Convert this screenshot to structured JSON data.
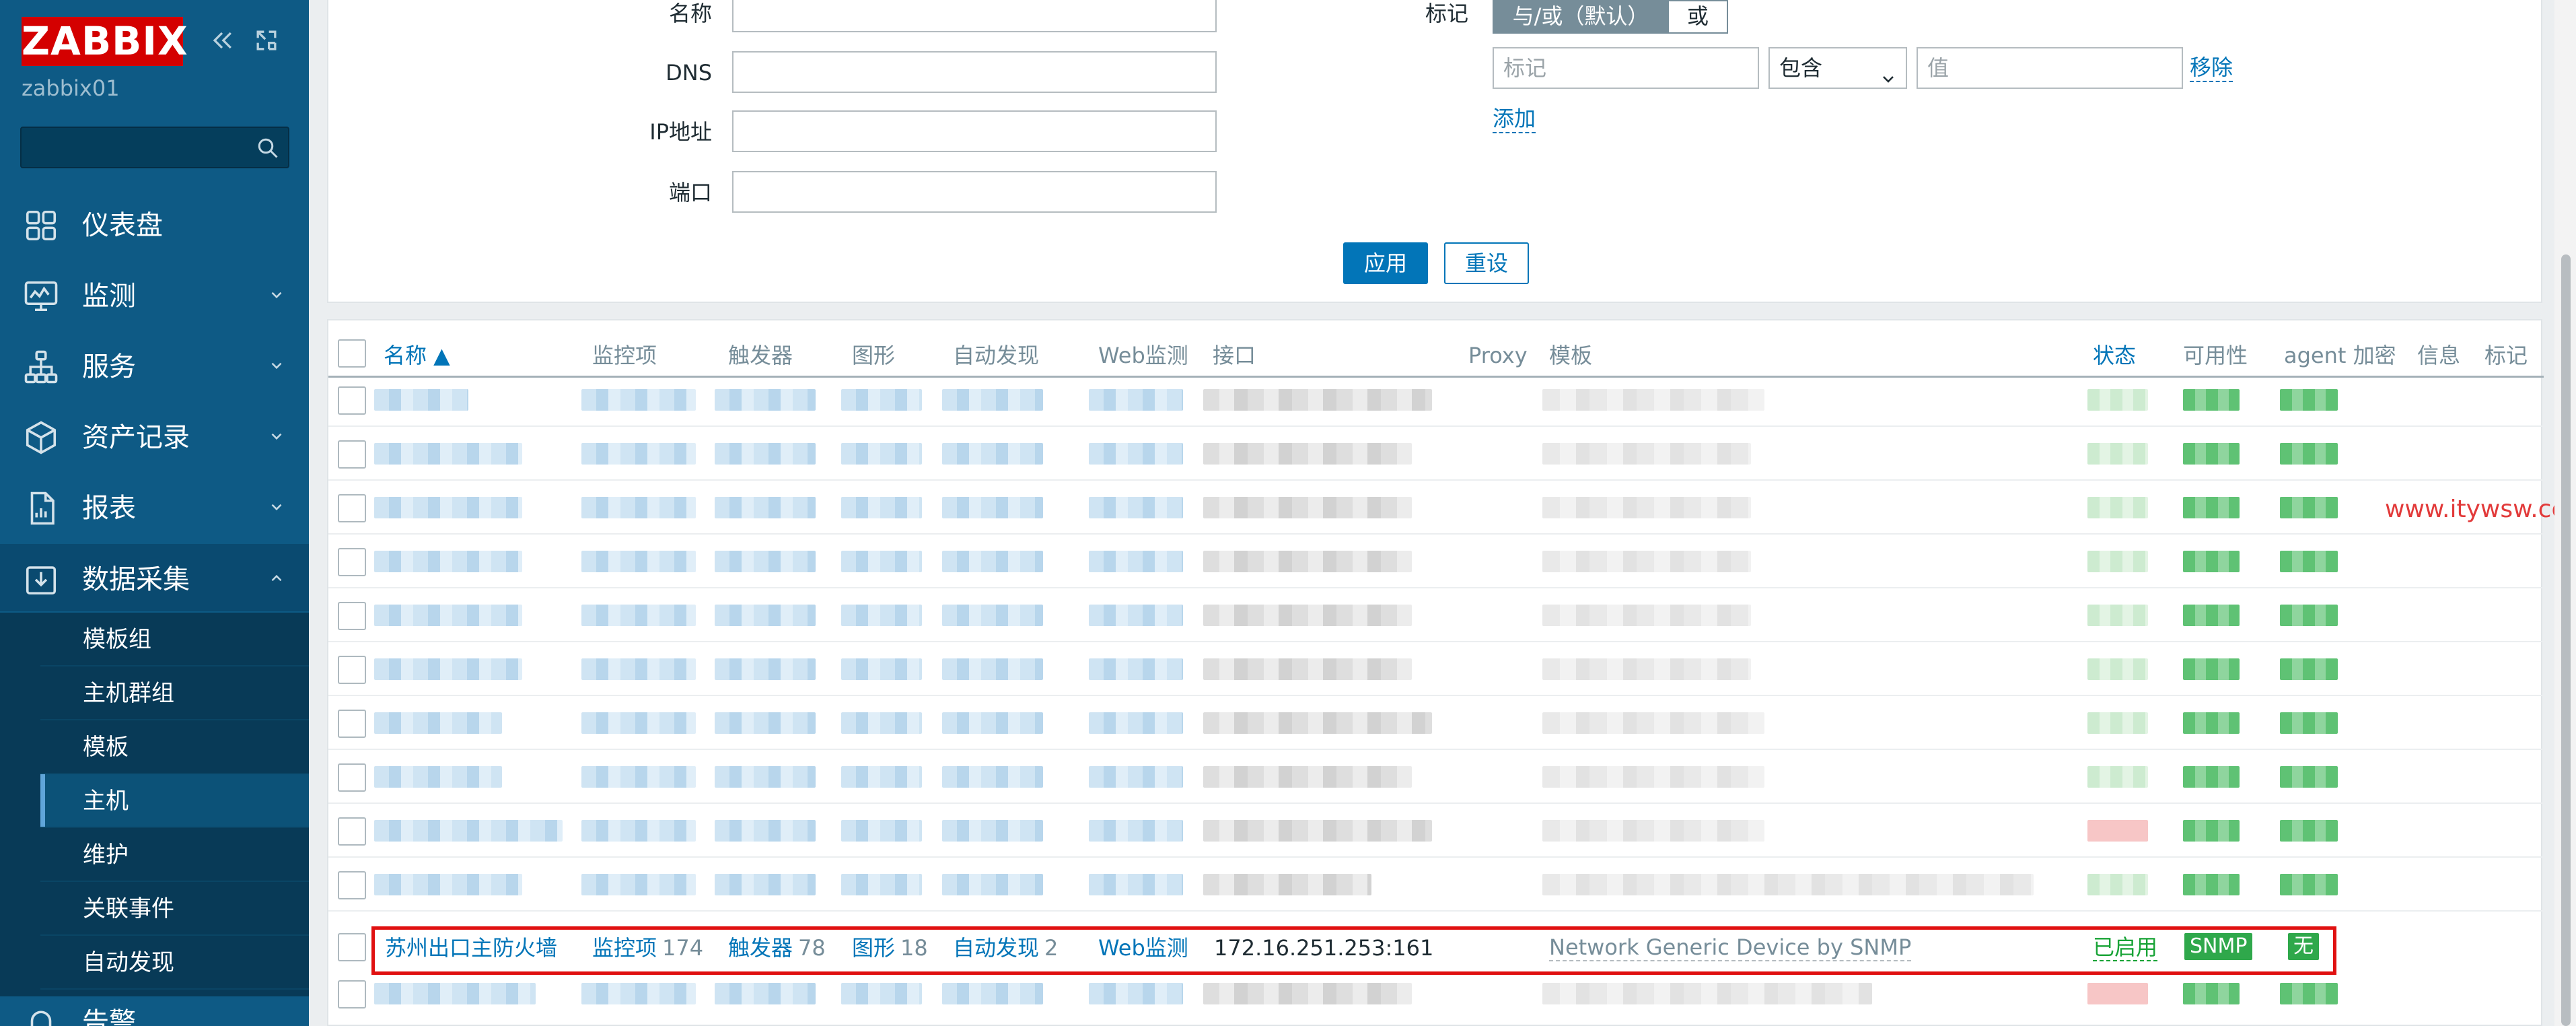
{
  "sidebar": {
    "logo": "ZABBIX",
    "username": "zabbix01",
    "search_placeholder": "",
    "menu": [
      {
        "label": "仪表盘",
        "icon": "dashboard-icon"
      },
      {
        "label": "监测",
        "icon": "monitoring-icon"
      },
      {
        "label": "服务",
        "icon": "services-icon"
      },
      {
        "label": "资产记录",
        "icon": "inventory-icon"
      },
      {
        "label": "报表",
        "icon": "reports-icon"
      },
      {
        "label": "数据采集",
        "icon": "data-collection-icon"
      },
      {
        "label": "告警",
        "icon": "alerts-icon"
      }
    ],
    "submenu": [
      "模板组",
      "主机群组",
      "模板",
      "主机",
      "维护",
      "关联事件",
      "自动发现"
    ],
    "submenu_current": "主机"
  },
  "filter": {
    "name_label": "名称",
    "dns_label": "DNS",
    "ip_label": "IP地址",
    "port_label": "端口",
    "tags_label": "标记",
    "tags_mode_and_or": "与/或（默认）",
    "tags_mode_or": "或",
    "tag_placeholder": "标记",
    "tag_operator": "包含",
    "value_placeholder": "值",
    "remove_link": "移除",
    "add_link": "添加",
    "apply_button": "应用",
    "reset_button": "重设"
  },
  "table": {
    "columns": {
      "name": "名称 ▲",
      "items": "监控项",
      "triggers": "触发器",
      "graphs": "图形",
      "discovery": "自动发现",
      "web": "Web监测",
      "interface": "接口",
      "proxy": "Proxy",
      "templates": "模板",
      "status": "状态",
      "availability": "可用性",
      "agent_encryption": "agent 加密",
      "info": "信息",
      "tags": "标记"
    },
    "highlighted_row": {
      "name": "苏州出口主防火墙",
      "items_label": "监控项",
      "items_count": "174",
      "triggers_label": "触发器",
      "triggers_count": "78",
      "graphs_label": "图形",
      "graphs_count": "18",
      "discovery_label": "自动发现",
      "discovery_count": "2",
      "web_label": "Web监测",
      "interface": "172.16.251.253:161",
      "template": "Network Generic Device by SNMP",
      "status": "已启用",
      "availability": "SNMP",
      "encryption": "无"
    }
  },
  "watermark": "www.itywsw.com",
  "colors": {
    "sidebar": "#0e5a85",
    "accent": "#0275b8",
    "enabled": "#18a336",
    "badge": "#2fa84b",
    "highlight": "#e01010",
    "logo": "#d40000"
  }
}
